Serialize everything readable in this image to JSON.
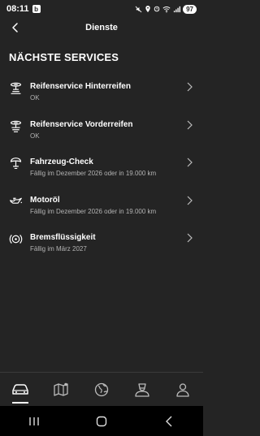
{
  "status_bar": {
    "time": "08:11",
    "app_badge": "b",
    "battery": "97"
  },
  "header": {
    "title": "Dienste",
    "back_icon": "arrow-left-icon"
  },
  "section": {
    "title": "NÄCHSTE SERVICES"
  },
  "services": [
    {
      "title": "Reifenservice Hinterreifen",
      "subtitle": "OK",
      "icon": "tire-icon"
    },
    {
      "title": "Reifenservice Vorderreifen",
      "subtitle": "OK",
      "icon": "tire-icon"
    },
    {
      "title": "Fahrzeug-Check",
      "subtitle": "Fällig im Dezember 2026 oder in 19.000 km",
      "icon": "vehicle-check-icon"
    },
    {
      "title": "Motoröl",
      "subtitle": "Fällig im Dezember 2026 oder in 19.000 km",
      "icon": "oil-can-icon"
    },
    {
      "title": "Bremsflüssigkeit",
      "subtitle": "Fällig im März 2027",
      "icon": "brake-icon"
    }
  ],
  "bottom_nav": [
    {
      "icon": "car-icon",
      "active": true
    },
    {
      "icon": "map-icon",
      "active": false
    },
    {
      "icon": "globe-icon",
      "active": false
    },
    {
      "icon": "service-person-icon",
      "active": false
    },
    {
      "icon": "user-icon",
      "active": false
    }
  ],
  "colors": {
    "background": "#242424",
    "text_primary": "#ffffff",
    "text_secondary": "#b3b3b3",
    "system_nav": "#000000"
  }
}
